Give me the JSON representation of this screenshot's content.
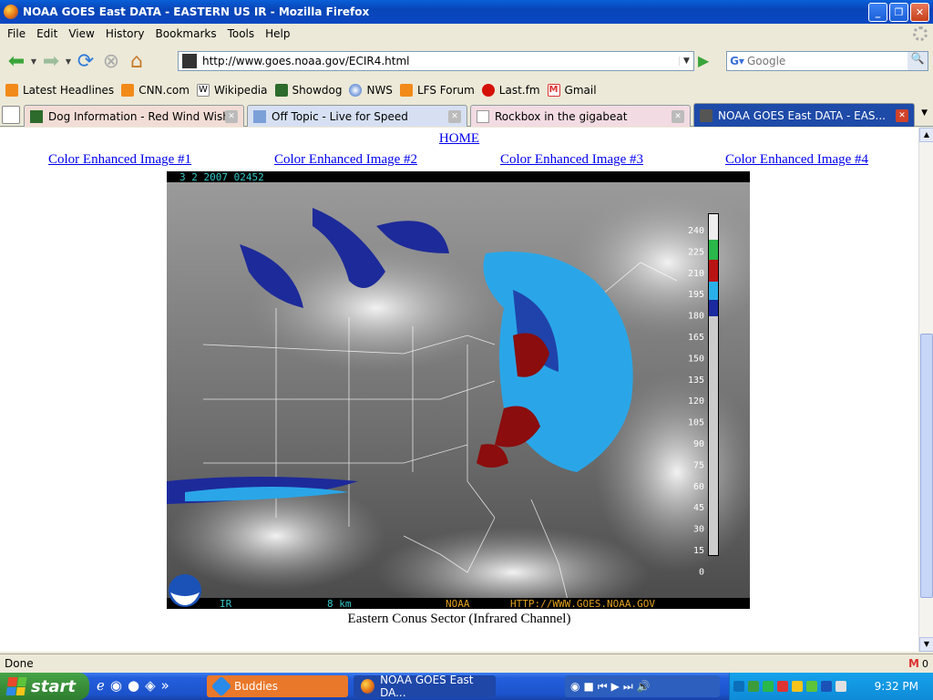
{
  "window": {
    "title": "NOAA GOES East DATA - EASTERN US IR - Mozilla Firefox"
  },
  "menu": [
    "File",
    "Edit",
    "View",
    "History",
    "Bookmarks",
    "Tools",
    "Help"
  ],
  "nav": {
    "url": "http://www.goes.noaa.gov/ECIR4.html",
    "search_placeholder": "Google"
  },
  "bookmarks": [
    {
      "label": "Latest Headlines",
      "icon": "rss-icon"
    },
    {
      "label": "CNN.com",
      "icon": "rss-icon"
    },
    {
      "label": "Wikipedia",
      "icon": "wikipedia-icon"
    },
    {
      "label": "Showdog",
      "icon": "dog-icon"
    },
    {
      "label": "NWS",
      "icon": "nws-icon"
    },
    {
      "label": "LFS Forum",
      "icon": "rss-icon"
    },
    {
      "label": "Last.fm",
      "icon": "lastfm-icon"
    },
    {
      "label": "Gmail",
      "icon": "gmail-icon"
    }
  ],
  "tabs": [
    {
      "label": "Dog Information - Red Wind Wish Upo...",
      "active": false
    },
    {
      "label": "Off Topic - Live for Speed",
      "active": false
    },
    {
      "label": "Rockbox in the gigabeat",
      "active": false
    },
    {
      "label": "NOAA GOES East DATA - EAS...",
      "active": true
    }
  ],
  "page": {
    "home_link": "HOME",
    "enhanced_links": [
      "Color Enhanced Image #1",
      "Color Enhanced Image #2",
      "Color Enhanced Image #3",
      "Color Enhanced Image #4"
    ],
    "image": {
      "header_text": "3  2  2007  02452",
      "band": "IR",
      "resolution": "8 km",
      "agency": "NOAA",
      "website": "HTTP://WWW.GOES.NOAA.GOV",
      "scale_labels": [
        "240",
        "225",
        "210",
        "195",
        "180",
        "165",
        "150",
        "135",
        "120",
        "105",
        "90",
        "75",
        "60",
        "45",
        "30",
        "15",
        "0"
      ]
    },
    "caption": "Eastern Conus Sector (Infrared Channel)"
  },
  "status": {
    "text": "Done",
    "gmail_count": "0"
  },
  "taskbar": {
    "start_label": "start",
    "items": [
      {
        "label": "Buddies",
        "active": true
      },
      {
        "label": "NOAA GOES East DA...",
        "active": false
      }
    ],
    "clock": "9:32 PM"
  },
  "colors": {
    "link": "#0000ee",
    "active_tab": "#1e4aa8",
    "taskbar": "#245edb",
    "tray": "#0f8bd8"
  }
}
